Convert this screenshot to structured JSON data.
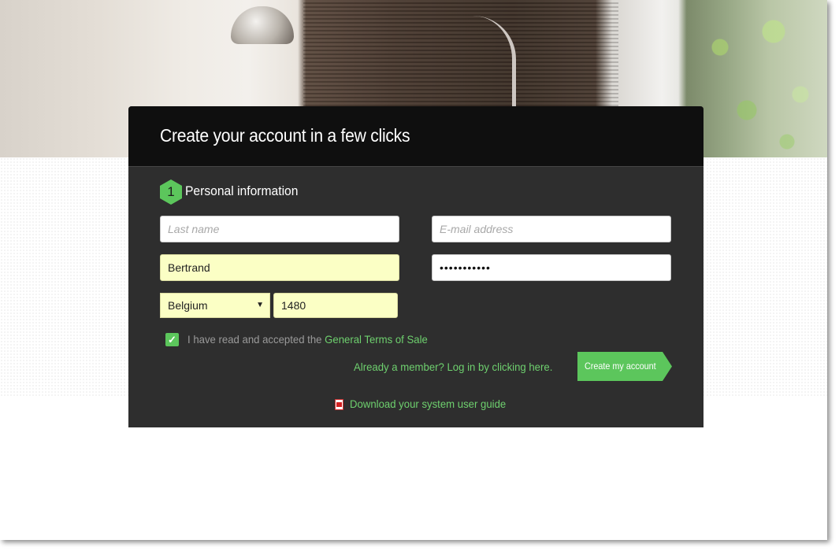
{
  "panel": {
    "title": "Create your account in a few clicks"
  },
  "step": {
    "number": "1",
    "label": "Personal information"
  },
  "form": {
    "last_name": {
      "placeholder": "Last name",
      "value": ""
    },
    "email": {
      "placeholder": "E-mail address",
      "value": ""
    },
    "first_name": {
      "value": "Bertrand"
    },
    "password": {
      "value": "•••••••••••"
    },
    "country": {
      "selected": "Belgium"
    },
    "postal_code": {
      "value": "1480"
    }
  },
  "terms": {
    "checked": true,
    "text": "I have read and accepted the ",
    "link": "General Terms of Sale"
  },
  "already_member": "Already a member? Log in by clicking here.",
  "create_button": "Create my account",
  "download": {
    "label": "Download your system user guide",
    "icon": "pdf-icon"
  },
  "colors": {
    "accent": "#5cc65c",
    "panel": "#2e2e2e",
    "filled_field": "#fbffc5"
  }
}
